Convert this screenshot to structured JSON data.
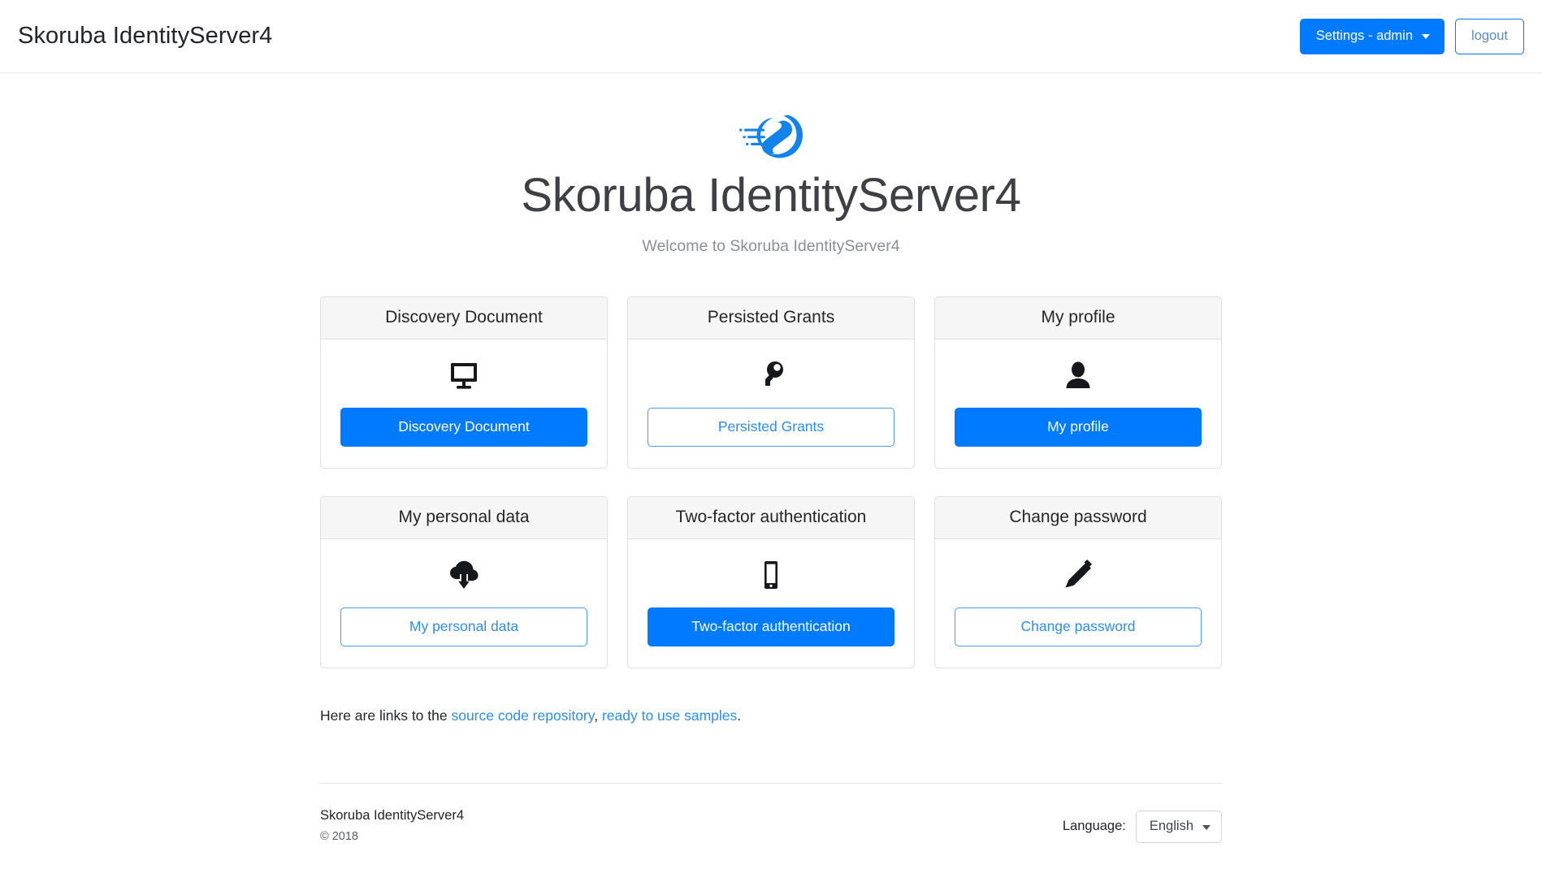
{
  "navbar": {
    "brand": "Skoruba IdentityServer4",
    "settings_label": "Settings - admin",
    "logout_label": "logout"
  },
  "hero": {
    "logo_name": "skoruba-logo",
    "title": "Skoruba IdentityServer4",
    "subtitle": "Welcome to Skoruba IdentityServer4"
  },
  "cards": [
    {
      "title": "Discovery Document",
      "icon": "desktop-monitor-icon",
      "button_label": "Discovery Document",
      "button_style": "primary"
    },
    {
      "title": "Persisted Grants",
      "icon": "key-icon",
      "button_label": "Persisted Grants",
      "button_style": "outline"
    },
    {
      "title": "My profile",
      "icon": "user-person-icon",
      "button_label": "My profile",
      "button_style": "primary"
    },
    {
      "title": "My personal data",
      "icon": "cloud-download-icon",
      "button_label": "My personal data",
      "button_style": "outline"
    },
    {
      "title": "Two-factor authentication",
      "icon": "mobile-phone-icon",
      "button_label": "Two-factor authentication",
      "button_style": "primary"
    },
    {
      "title": "Change password",
      "icon": "pencil-edit-icon",
      "button_label": "Change password",
      "button_style": "outline"
    }
  ],
  "links_line": {
    "prefix": "Here are links to the ",
    "link1": "source code repository",
    "separator": ", ",
    "link2": "ready to use samples",
    "suffix": "."
  },
  "footer": {
    "name": "Skoruba IdentityServer4",
    "copyright": "© 2018",
    "language_label": "Language:",
    "language_value": "English"
  },
  "colors": {
    "accent": "#007bff",
    "link": "#2b8ef2",
    "card_header_bg": "#f6f6f6",
    "border": "#dfdfdf",
    "title_text": "#3f4045",
    "subtitle_text": "#8a8f96"
  }
}
